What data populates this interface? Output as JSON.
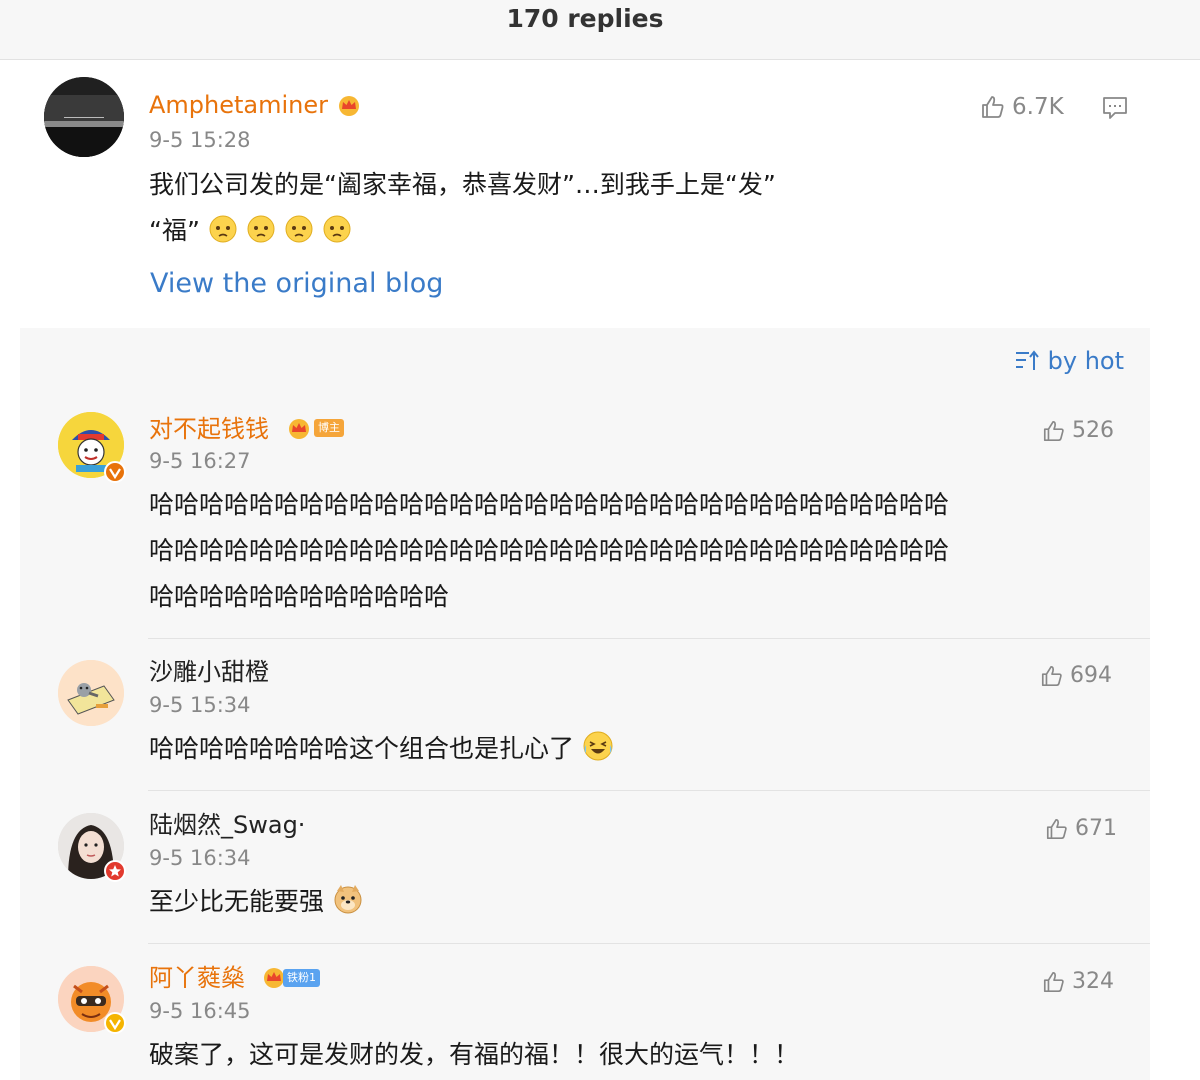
{
  "header": {
    "title": "170 replies"
  },
  "post": {
    "username": "Amphetaminer",
    "timestamp": "9-5 15:28",
    "text_line1": "我们公司发的是“阖家幸福，恭喜发财”…到我手上是“发”",
    "text_line2": "“福”",
    "likes": "6.7K",
    "view_original": "View the original blog"
  },
  "sort": {
    "label": "by hot"
  },
  "comments": [
    {
      "username": "对不起钱钱",
      "badge": "博主",
      "timestamp": "9-5 16:27",
      "text_line1": "哈哈哈哈哈哈哈哈哈哈哈哈哈哈哈哈哈哈哈哈哈哈哈哈哈哈哈哈哈哈哈哈",
      "text_line2": "哈哈哈哈哈哈哈哈哈哈哈哈哈哈哈哈哈哈哈哈哈哈哈哈哈哈哈哈哈哈哈哈",
      "text_line3": "哈哈哈哈哈哈哈哈哈哈哈哈",
      "likes": "526"
    },
    {
      "username": "沙雕小甜橙",
      "timestamp": "9-5 15:34",
      "text": "哈哈哈哈哈哈哈哈这个组合也是扎心了",
      "likes": "694"
    },
    {
      "username": "陆烟然_Swag·",
      "timestamp": "9-5 16:34",
      "text": "至少比无能要强",
      "likes": "671"
    },
    {
      "username": "阿丫蕤燊",
      "badge": "铁粉1",
      "timestamp": "9-5 16:45",
      "text": "破案了，这可是发财的发，有福的福！！很大的运气！！！",
      "likes": "324"
    }
  ],
  "colors": {
    "orange_name": "#e8730b",
    "link_blue": "#3a7bc8",
    "meta_gray": "#888888",
    "panel_bg": "#f7f7f7"
  },
  "icons": [
    "thumbs-up-icon",
    "comment-icon",
    "sort-icon",
    "crown-icon",
    "verified-badge-icon",
    "sad-face-emoji-icon",
    "laughing-crying-emoji-icon",
    "doge-emoji-icon"
  ]
}
